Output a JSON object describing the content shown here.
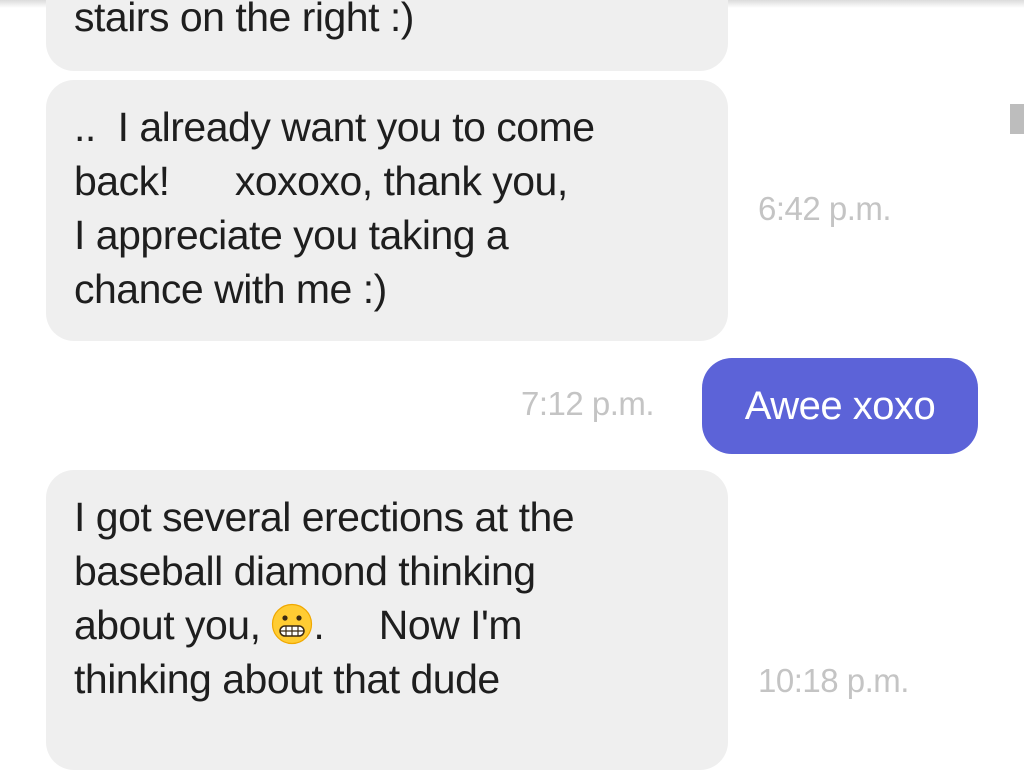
{
  "messages": [
    {
      "direction": "incoming",
      "lines": [
        "stairs on the right :)"
      ]
    },
    {
      "direction": "incoming",
      "lines": [
        "..  I already want you to come",
        "back!      xoxoxo, thank you,",
        "I appreciate you taking a",
        "chance with me :)"
      ],
      "time": "6:42 p.m."
    },
    {
      "direction": "outgoing",
      "text": "Awee xoxo",
      "time": "7:12 p.m."
    },
    {
      "direction": "incoming",
      "lines": [
        "I got several erections at the",
        "baseball diamond thinking",
        "about you,",
        ".     Now I'm",
        "thinking about that dude"
      ],
      "emoji": "grimacing-face-icon",
      "time": "10:18 p.m."
    }
  ],
  "colors": {
    "incoming_bubble": "#efefef",
    "incoming_text": "#1e1e1e",
    "outgoing_bubble": "#5c63d8",
    "outgoing_text": "#ffffff",
    "timestamp": "#c4c4c4",
    "scrollbar": "#bdbdbd"
  }
}
